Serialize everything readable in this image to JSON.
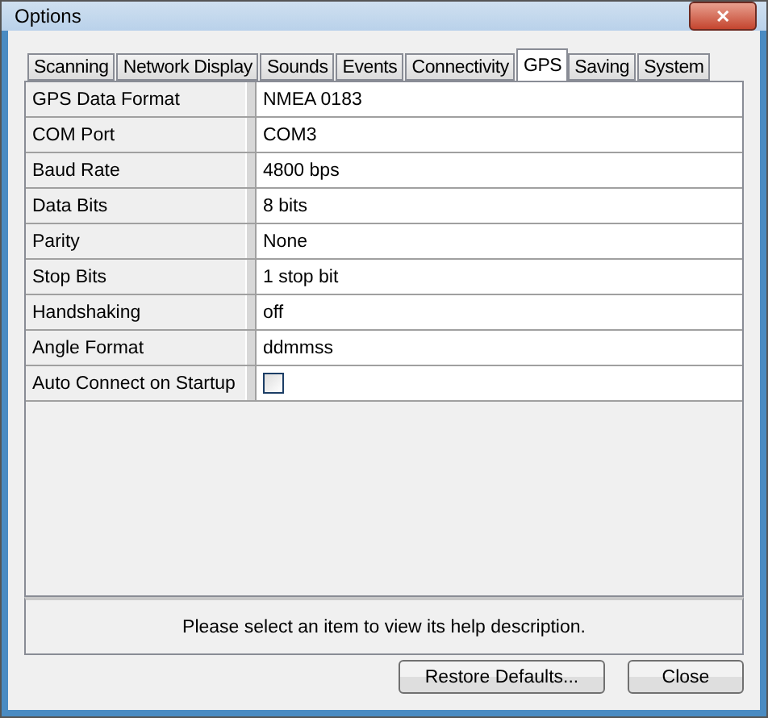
{
  "window": {
    "title": "Options",
    "close": "✕"
  },
  "tabs": [
    {
      "label": "Scanning",
      "selected": false
    },
    {
      "label": "Network Display",
      "selected": false
    },
    {
      "label": "Sounds",
      "selected": false
    },
    {
      "label": "Events",
      "selected": false
    },
    {
      "label": "Connectivity",
      "selected": false
    },
    {
      "label": "GPS",
      "selected": true
    },
    {
      "label": "Saving",
      "selected": false
    },
    {
      "label": "System",
      "selected": false
    }
  ],
  "properties": [
    {
      "kind": "text",
      "name": "GPS Data Format",
      "value": "NMEA 0183"
    },
    {
      "kind": "text",
      "name": "COM Port",
      "value": "COM3"
    },
    {
      "kind": "text",
      "name": "Baud Rate",
      "value": "4800 bps"
    },
    {
      "kind": "text",
      "name": "Data Bits",
      "value": "8 bits"
    },
    {
      "kind": "text",
      "name": "Parity",
      "value": "None"
    },
    {
      "kind": "text",
      "name": "Stop Bits",
      "value": "1 stop bit"
    },
    {
      "kind": "text",
      "name": "Handshaking",
      "value": "off"
    },
    {
      "kind": "text",
      "name": "Angle Format",
      "value": "ddmmss"
    },
    {
      "kind": "checkbox",
      "name": "Auto Connect on Startup",
      "checked": false
    }
  ],
  "help": "Please select an item to view its help description.",
  "buttons": [
    "Restore Defaults...",
    "Close"
  ]
}
